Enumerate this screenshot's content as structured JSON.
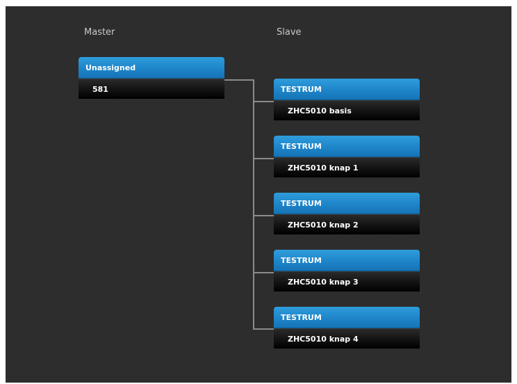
{
  "columns": {
    "master": "Master",
    "slave": "Slave"
  },
  "master": {
    "header": "Unassigned",
    "value": "581"
  },
  "slaves": [
    {
      "header": "TESTRUM",
      "value": "ZHC5010 basis"
    },
    {
      "header": "TESTRUM",
      "value": "ZHC5010 knap 1"
    },
    {
      "header": "TESTRUM",
      "value": "ZHC5010 knap 2"
    },
    {
      "header": "TESTRUM",
      "value": "ZHC5010 knap 3"
    },
    {
      "header": "TESTRUM",
      "value": "ZHC5010 knap 4"
    }
  ]
}
